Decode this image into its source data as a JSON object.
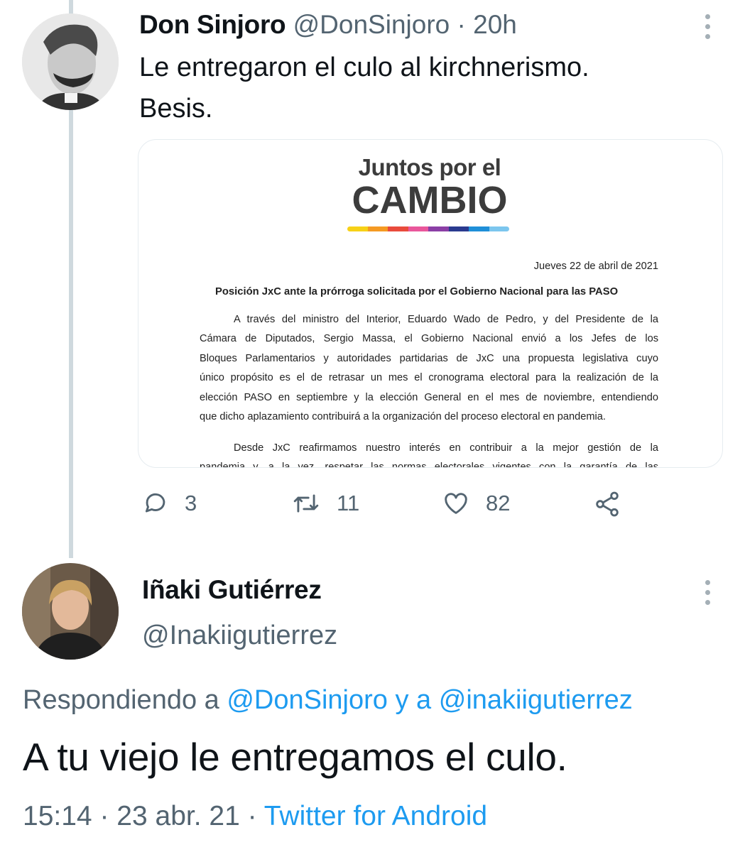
{
  "tweet": {
    "author_name": "Don Sinjoro",
    "author_handle": "@DonSinjoro",
    "separator": "·",
    "time": "20h",
    "text_line1": "Le entregaron el culo al kirchnerismo.",
    "text_line2": "Besis.",
    "image": {
      "logo_line1": "Juntos por el",
      "logo_line2": "CAMBIO",
      "stripe_colors": [
        "#f7d117",
        "#f59a23",
        "#e94b3c",
        "#e9579b",
        "#8b3fa6",
        "#2a3a8f",
        "#1f8fd8",
        "#7cc6ee"
      ],
      "date": "Jueves 22 de abril de 2021",
      "heading": "Posición JxC ante la prórroga solicitada por el Gobierno Nacional para las PASO",
      "para1_lines": [
        "A través del ministro del Interior, Eduardo Wado de Pedro, y del Presidente de la",
        "Cámara de Diputados, Sergio Massa, el Gobierno Nacional  envió a los Jefes de los",
        "Bloques Parlamentarios y autoridades partidarias de JxC una propuesta legislativa cuyo",
        "único propósito es el de retrasar un mes el cronograma electoral para la realización de la",
        "elección PASO en septiembre y la elección General en el mes de noviembre, entendiendo",
        "que dicho aplazamiento contribuirá a la organización del proceso electoral en pandemia."
      ],
      "para2_lines": [
        "Desde JxC reafirmamos nuestro interés en contribuir a la mejor gestión de la",
        "pandemia y, a la vez, respetar las normas electorales vigentes con la garantía de las"
      ]
    },
    "actions": {
      "replies": "3",
      "retweets": "11",
      "likes": "82"
    }
  },
  "reply": {
    "author_name": "Iñaki Gutiérrez",
    "author_handle": "@Inakiigutierrez",
    "replying_prefix": "Respondiendo a",
    "replying_to_1": "@DonSinjoro",
    "replying_joiner": "y a",
    "replying_to_2": "@inakiigutierrez",
    "text": "A tu viejo le entregamos el culo.",
    "time": "15:14",
    "date": "23 abr. 21",
    "separator": "·",
    "source": "Twitter for Android"
  },
  "colors": {
    "accent": "#1d9bf0",
    "secondary_text": "#536471",
    "thread_line": "#cfd9de"
  }
}
